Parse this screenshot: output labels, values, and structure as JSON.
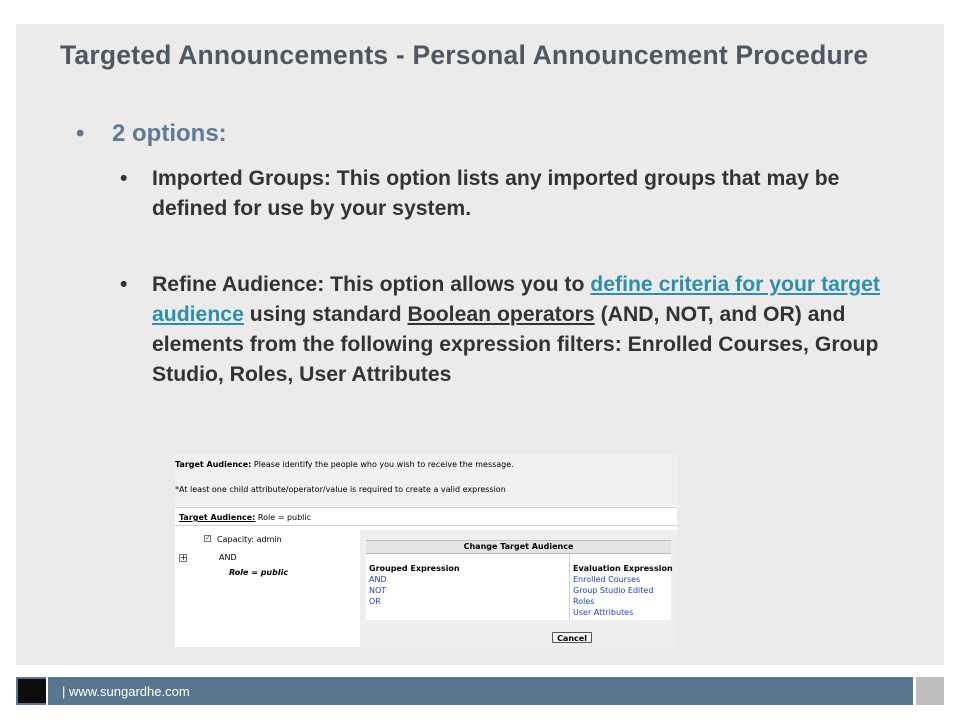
{
  "slide": {
    "title": "Targeted Announcements  - Personal Announcement Procedure",
    "bullet_main": "2 options:",
    "bullet_1": "Imported Groups: This option lists any imported groups that may be defined for use by your system.",
    "bullet_2_pre": "Refine Audience: This option allows you to ",
    "bullet_2_link": "define criteria for your target audience",
    "bullet_2_mid": " using standard ",
    "bullet_2_underlined": "Boolean operators",
    "bullet_2_post": " (AND, NOT, and OR) and elements from the following expression filters: Enrolled Courses, Group Studio, Roles, User Attributes",
    "bullet_glyph": "•"
  },
  "screenshot": {
    "target_label": "Target Audience:",
    "target_instruction": "Please identify the people who you wish to receive the message.",
    "note": "*At least one child attribute/operator/value is required to create a valid expression",
    "target_label_2": "Target Audience:",
    "target_value": "Role = public",
    "capacity": "Capacity:  admin",
    "and": "AND",
    "role_public": "Role = public",
    "dialog_title": "Change Target Audience",
    "grouped_header": "Grouped Expression",
    "grouped_items": [
      "AND",
      "NOT",
      "OR"
    ],
    "evaluation_header": "Evaluation Expression",
    "evaluation_items": [
      "Enrolled Courses",
      "Group Studio Edited",
      "Roles",
      "User Attributes"
    ],
    "cancel": "Cancel"
  },
  "footer": {
    "url": "| www.sungardhe.com"
  },
  "colors": {
    "title": "#4d5865",
    "subtitle": "#5d7a96",
    "link": "#2a8fb0",
    "footer_bar": "#5a768f"
  }
}
